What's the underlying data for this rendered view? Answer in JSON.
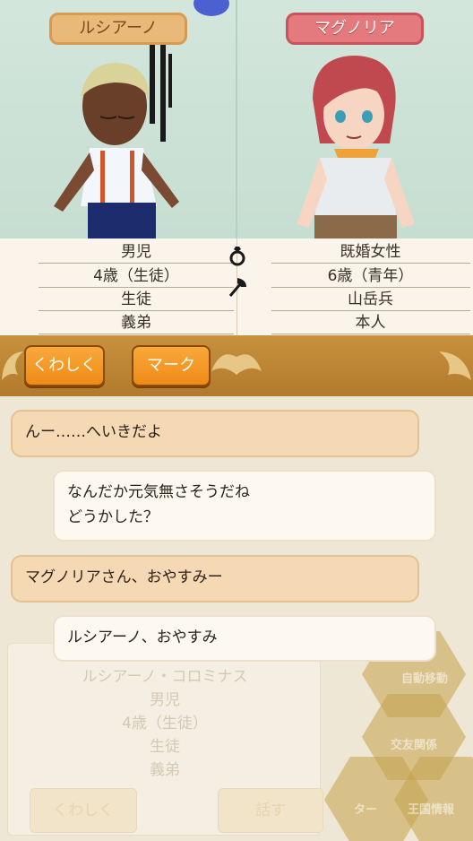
{
  "characters": {
    "left": {
      "name": "ルシアーノ",
      "info": [
        "男児",
        "4歳（生徒）",
        "生徒",
        "義弟"
      ]
    },
    "right": {
      "name": "マグノリア",
      "info": [
        "既婚女性",
        "6歳（青年）",
        "山岳兵",
        "本人"
      ]
    }
  },
  "buttons": {
    "details": "くわしく",
    "mark": "マーク"
  },
  "messages": [
    {
      "side": "left",
      "text": "んー……へいきだよ"
    },
    {
      "side": "right",
      "lines": [
        "なんだか元気無さそうだね",
        "どうかした？"
      ]
    },
    {
      "side": "left",
      "text": "マグノリアさん、おやすみー"
    },
    {
      "side": "right",
      "text": "ルシアーノ、おやすみ"
    }
  ],
  "background": {
    "panel_lines": [
      "ルシアーノ・コロミナス",
      "男児",
      "4歳（生徒）",
      "生徒",
      "義弟"
    ],
    "btn_details": "くわしく",
    "btn_talk": "話す",
    "menu": [
      "自動移動",
      "交友関係",
      "ター",
      "王国情報"
    ]
  },
  "colors": {
    "left_badge": "#e9b97a",
    "right_badge": "#e57a7e",
    "button_orange": "#f39b25",
    "bar_gold": "#b98030",
    "bubble_in": "#f5d9b5",
    "bubble_out": "#fdf9f1"
  },
  "icons": {
    "ring": "ring-icon",
    "axe": "axe-icon"
  }
}
